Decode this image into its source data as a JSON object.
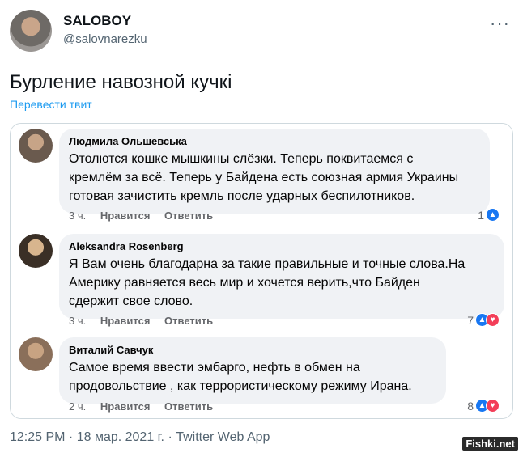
{
  "author": {
    "name": "SALOBOY",
    "handle": "@salovnarezku"
  },
  "more_glyph": "···",
  "tweet": {
    "text": "Бурление навозной кучкі",
    "translate_link": "Перевести твит",
    "footer": "12:25 PM · 18 мар. 2021 г. · Twitter Web App"
  },
  "comments": [
    {
      "author": "Людмила Ольшевська",
      "text": "Отолются кошке мышкины слёзки. Теперь поквитаемся  с\nкремлём за всё. Теперь у Байдена есть союзная армия Украины\nготовая зачистить кремль после ударных беспилотников.",
      "time": "3 ч.",
      "like_label": "Нравится",
      "reply_label": "Ответить",
      "reaction_count": "1",
      "reactions": [
        "like"
      ]
    },
    {
      "author": "Aleksandra Rosenberg",
      "text": "Я Вам очень благодарна за такие правильные и точные слова.На\nАмерику равняется весь мир и хочется верить,что Байден\nсдержит свое слово.",
      "time": "3 ч.",
      "like_label": "Нравится",
      "reply_label": "Ответить",
      "reaction_count": "7",
      "reactions": [
        "like",
        "love"
      ]
    },
    {
      "author": "Виталий Савчук",
      "text": "Самое время ввести эмбарго, нефть в обмен на\nпродовольствие , как террористическому режиму Ирана.",
      "time": "2 ч.",
      "like_label": "Нравится",
      "reply_label": "Ответить",
      "reaction_count": "8",
      "reactions": [
        "like",
        "love"
      ]
    }
  ],
  "watermark": "Fishki.net",
  "colors": {
    "link": "#1d9bf0",
    "fb_like": "#1877f2",
    "fb_love": "#f33e58",
    "bubble": "#f0f2f5"
  }
}
